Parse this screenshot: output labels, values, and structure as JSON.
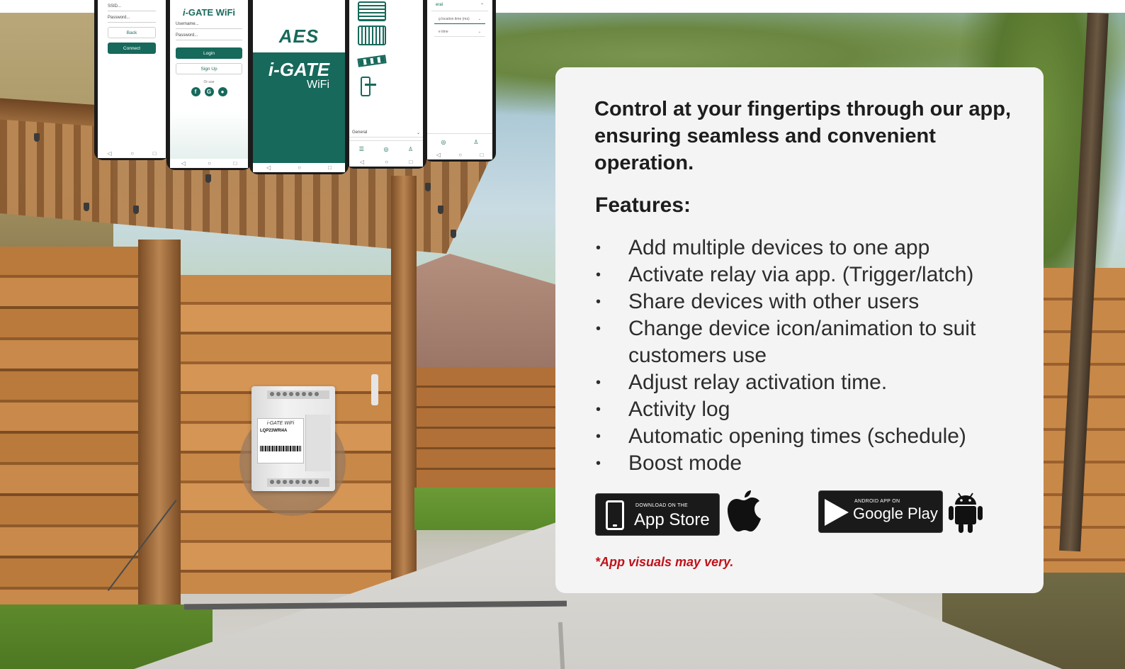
{
  "panel": {
    "headline": "Control at your fingertips through our app, ensuring seamless and convenient operation.",
    "features_title": "Features:",
    "bullet": "•",
    "features": [
      "Add multiple devices to one app",
      "Activate relay via app. (Trigger/latch)",
      "Share devices with other users",
      "Change device icon/animation to suit customers use",
      "Adjust relay activation time.",
      "Activity log",
      "Automatic opening times (schedule)",
      "Boost mode"
    ],
    "disclaimer": "*App visuals may very."
  },
  "badges": {
    "app_store": {
      "small": "DOWNLOAD ON THE",
      "big": "App Store"
    },
    "google_play": {
      "small": "ANDROID APP ON",
      "big": "Google Play"
    }
  },
  "phones": {
    "p1": {
      "ssid": "SSID...",
      "password": "Password...",
      "back": "Back",
      "connect": "Connect"
    },
    "p2": {
      "brand_i": "i",
      "brand_rest": "-GATE WiFi",
      "username": "Username...",
      "password": "Password...",
      "login": "Login",
      "signup": "Sign Up",
      "or_use": "Or use",
      "social": [
        "f",
        "G",
        "●"
      ]
    },
    "p3": {
      "logo": "AES",
      "title": "i-GATE",
      "subtitle": "WiFi"
    },
    "p4": {
      "select": "General"
    },
    "p5": {
      "accordion": "eral",
      "field1": "g location time (ms)",
      "field2": "e time"
    },
    "nav": [
      "◁",
      "○",
      "□"
    ]
  },
  "device": {
    "brand": "i-GATE WiFi",
    "model": "LQP23WRI4A"
  },
  "colors": {
    "brand_green": "#16695b",
    "panel_bg": "#f4f4f4",
    "disclaimer_red": "#c0121a"
  }
}
